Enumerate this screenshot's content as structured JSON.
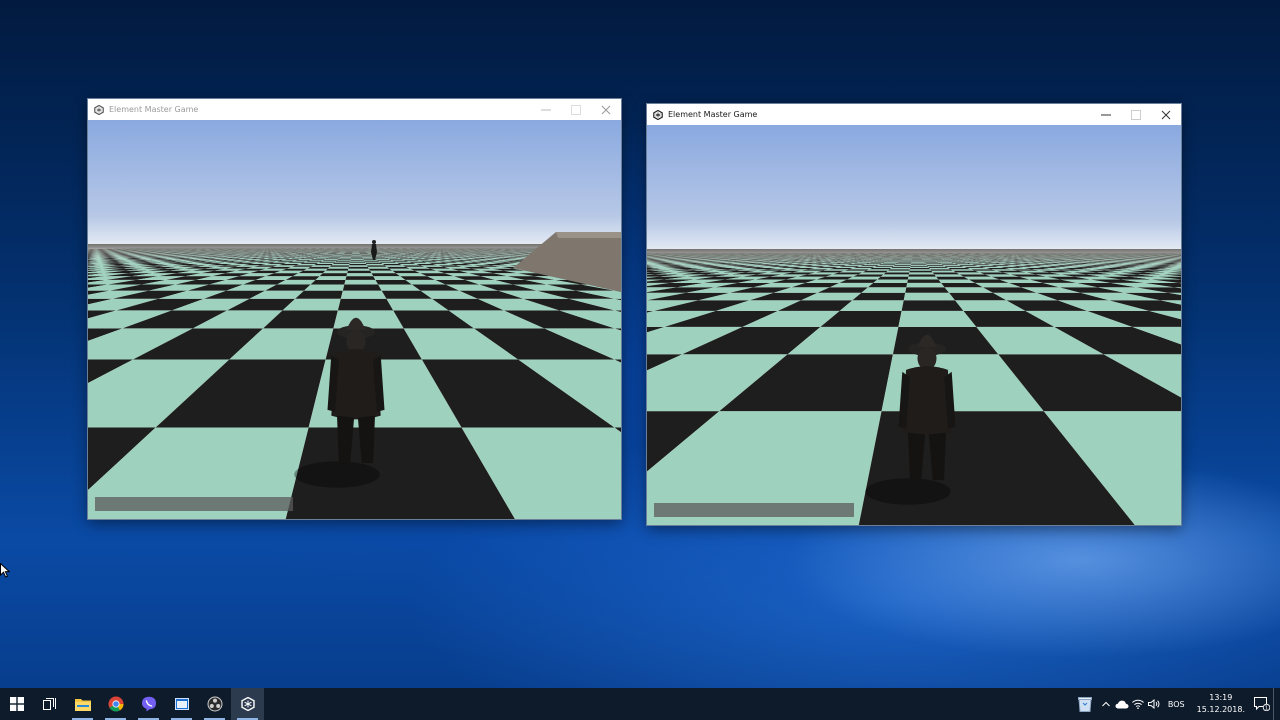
{
  "desktop": {
    "windows": [
      {
        "title": "Element Master Game",
        "state": "inactive"
      },
      {
        "title": "Element Master Game",
        "state": "active"
      }
    ]
  },
  "taskbar": {
    "start_icon": "windows-logo-icon",
    "pinned": [
      {
        "name": "task-view-icon"
      },
      {
        "name": "file-explorer-icon"
      },
      {
        "name": "chrome-icon"
      },
      {
        "name": "viber-icon"
      },
      {
        "name": "app-window-icon"
      },
      {
        "name": "obs-icon"
      },
      {
        "name": "unity-icon"
      }
    ],
    "tray": {
      "language": "BOS",
      "time": "13:19",
      "date": "15.12.2018.",
      "notifications": "1"
    }
  },
  "colors": {
    "tile_light": "#9ed2bf",
    "tile_dark": "#1e1e1e",
    "sky_top": "#8aa9e0",
    "horizon": "#c8d6e8"
  }
}
